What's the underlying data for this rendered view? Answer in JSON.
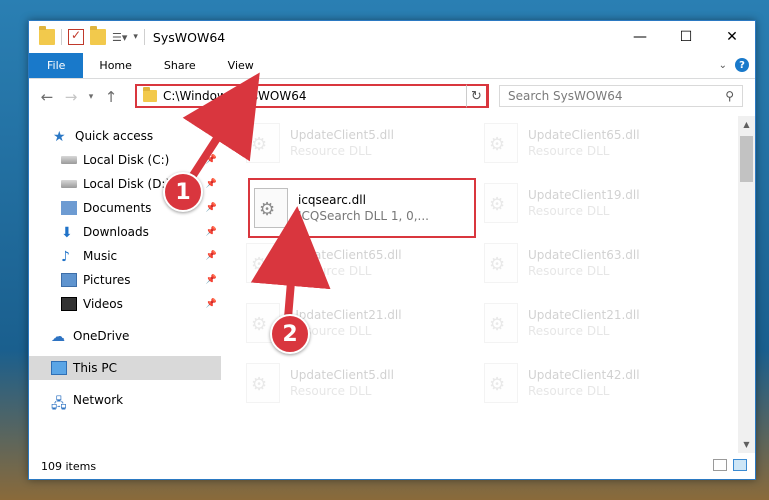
{
  "window": {
    "title": "SysWOW64",
    "controls": {
      "minimize": "—",
      "maximize": "☐",
      "close": "✕"
    }
  },
  "ribbon": {
    "tabs": [
      "File",
      "Home",
      "Share",
      "View"
    ],
    "help": "?"
  },
  "address": {
    "path": "C:\\Windows\\SysWOW64"
  },
  "search": {
    "placeholder": "Search SysWOW64"
  },
  "nav": {
    "items": [
      {
        "label": "Quick access",
        "icon": "star-icon"
      },
      {
        "label": "Local Disk (C:)",
        "icon": "drive-icon",
        "pinned": true
      },
      {
        "label": "Local Disk (D:)",
        "icon": "drive-icon",
        "pinned": true
      },
      {
        "label": "Documents",
        "icon": "documents-icon",
        "pinned": true
      },
      {
        "label": "Downloads",
        "icon": "download-icon",
        "pinned": true
      },
      {
        "label": "Music",
        "icon": "music-icon",
        "pinned": true
      },
      {
        "label": "Pictures",
        "icon": "pictures-icon",
        "pinned": true
      },
      {
        "label": "Videos",
        "icon": "videos-icon",
        "pinned": true
      },
      {
        "label": "OneDrive",
        "icon": "cloud-icon"
      },
      {
        "label": "This PC",
        "icon": "pc-icon",
        "selected": true
      },
      {
        "label": "Network",
        "icon": "network-icon"
      }
    ]
  },
  "files": {
    "highlighted": {
      "name": "icqsearc.dll",
      "desc": "ICQSearch DLL 1, 0,..."
    },
    "faded": [
      {
        "name": "UpdateClient5.dll",
        "desc": "Resource DLL"
      },
      {
        "name": "UpdateClient65.dll",
        "desc": "Resource DLL"
      },
      {
        "name": "UpdateClient19.dll",
        "desc": "Resource DLL"
      },
      {
        "name": "UpdateClient65.dll",
        "desc": "Resource DLL"
      },
      {
        "name": "UpdateClient63.dll",
        "desc": "Resource DLL"
      },
      {
        "name": "UpdateClient21.dll",
        "desc": "Resource DLL"
      },
      {
        "name": "UpdateClient21.dll",
        "desc": "Resource DLL"
      },
      {
        "name": "UpdateClient5.dll",
        "desc": "Resource DLL"
      },
      {
        "name": "UpdateClient42.dll",
        "desc": "Resource DLL"
      }
    ]
  },
  "status": {
    "count": "109 items"
  },
  "annotations": {
    "step1": "1",
    "step2": "2",
    "color": "#d9363e"
  }
}
